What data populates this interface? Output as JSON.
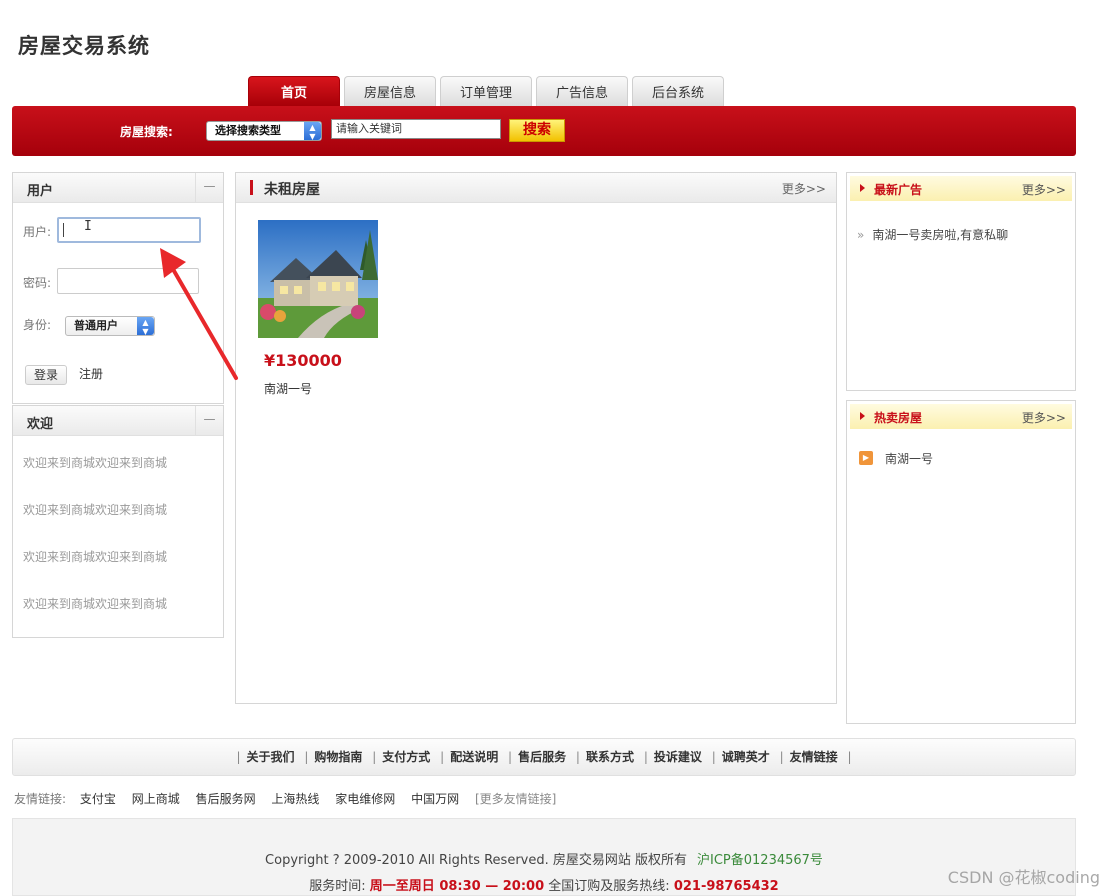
{
  "site": {
    "title": "房屋交易系统"
  },
  "tabs": [
    {
      "label": "首页",
      "active": true
    },
    {
      "label": "房屋信息",
      "active": false
    },
    {
      "label": "订单管理",
      "active": false
    },
    {
      "label": "广告信息",
      "active": false
    },
    {
      "label": "后台系统",
      "active": false
    }
  ],
  "search": {
    "label": "房屋搜索:",
    "type_selected": "选择搜索类型",
    "keyword_placeholder": "请输入关键词",
    "button_label": "搜索"
  },
  "user_panel": {
    "title": "用户",
    "collapse": "—",
    "username_label": "用户:",
    "username_value": "",
    "password_label": "密码:",
    "password_value": "",
    "role_label": "身份:",
    "role_selected": "普通用户",
    "login_label": "登录",
    "register_label": "注册"
  },
  "welcome_panel": {
    "title": "欢迎",
    "collapse": "—",
    "lines": [
      "欢迎来到商城欢迎来到商城",
      "欢迎来到商城欢迎来到商城",
      "欢迎来到商城欢迎来到商城",
      "欢迎来到商城欢迎来到商城"
    ]
  },
  "unrented_panel": {
    "title": "未租房屋",
    "more": "更多>>",
    "houses": [
      {
        "price": "¥130000",
        "name": "南湖一号"
      }
    ]
  },
  "ads_panel": {
    "title": "最新广告",
    "more": "更多>>",
    "items": [
      {
        "bullet": "»",
        "text": "南湖一号卖房啦,有意私聊"
      }
    ]
  },
  "hot_panel": {
    "title": "热卖房屋",
    "more": "更多>>",
    "items": [
      {
        "text": "南湖一号"
      }
    ]
  },
  "footer": {
    "nav": [
      "关于我们",
      "购物指南",
      "支付方式",
      "配送说明",
      "售后服务",
      "联系方式",
      "投诉建议",
      "诚聘英才",
      "友情链接"
    ],
    "nav_separator": "|",
    "friend_label": "友情链接:",
    "friend_links": [
      "支付宝",
      "网上商城",
      "售后服务网",
      "上海热线",
      "家电维修网",
      "中国万网"
    ],
    "friend_more": "[更多友情链接]",
    "copyright": "Copyright ? 2009-2010 All Rights Reserved. 房屋交易网站 版权所有",
    "icp": "沪ICP备01234567号",
    "service_label": "服务时间:",
    "service_time": "周一至周日 08:30 — 20:00",
    "hotline_label": "全国订购及服务热线:",
    "hotline": "021-98765432"
  },
  "watermark": "CSDN @花椒coding",
  "colors": {
    "brand_red": "#c8101a",
    "search_button": "#f2c100",
    "annotation_arrow": "#e8282b"
  }
}
